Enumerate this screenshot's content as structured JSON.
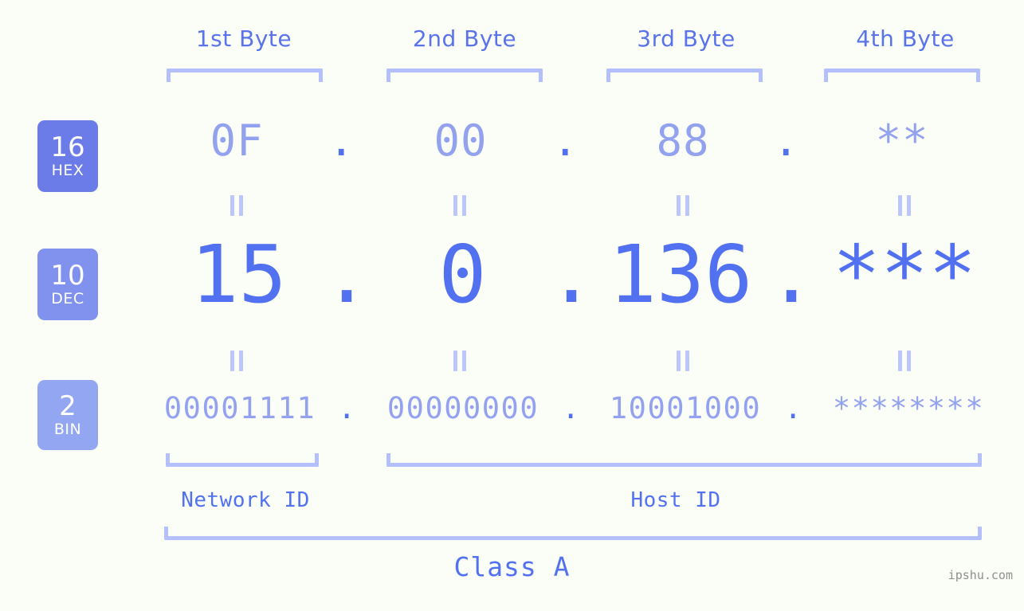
{
  "meta": {
    "watermark": "ipshu.com",
    "background_color": "#fbfdf7",
    "accent_strong": "#5271f0",
    "accent_light": "#93a2ef",
    "bracket_color": "#b4c0fb"
  },
  "byte_headers": [
    {
      "label": "1st Byte"
    },
    {
      "label": "2nd Byte"
    },
    {
      "label": "3rd Byte"
    },
    {
      "label": "4th Byte"
    }
  ],
  "bases": [
    {
      "id": "hex",
      "number": "16",
      "name": "HEX",
      "color": "#6b7ce9"
    },
    {
      "id": "dec",
      "number": "10",
      "name": "DEC",
      "color": "#8092ee"
    },
    {
      "id": "bin",
      "number": "2",
      "name": "BIN",
      "color": "#93a6f2"
    }
  ],
  "rows": {
    "hex": {
      "values": [
        "0F",
        "00",
        "88",
        "**"
      ],
      "separator": "."
    },
    "dec": {
      "values": [
        "15",
        "0",
        "136",
        "***"
      ],
      "separator": "."
    },
    "bin": {
      "values": [
        "00001111",
        "00000000",
        "10001000",
        "********"
      ],
      "separator": "."
    }
  },
  "equals_symbol": "=",
  "id_sections": [
    {
      "label": "Network ID"
    },
    {
      "label": "Host ID"
    }
  ],
  "class_label": "Class A"
}
